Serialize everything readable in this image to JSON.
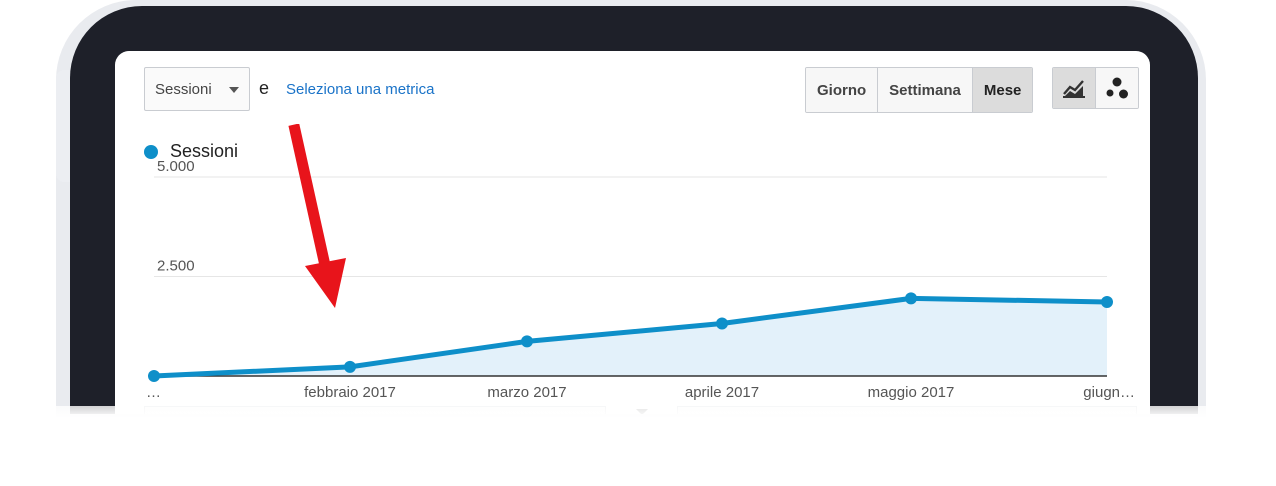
{
  "toolbar": {
    "metric_selected": "Sessioni",
    "conjunction": "e",
    "secondary_metric_link": "Seleziona una metrica",
    "periods": [
      {
        "label": "Giorno",
        "active": false
      },
      {
        "label": "Settimana",
        "active": false
      },
      {
        "label": "Mese",
        "active": true
      }
    ],
    "views": [
      {
        "icon": "line-chart-icon",
        "active": true
      },
      {
        "icon": "motion-chart-icon",
        "active": false
      }
    ]
  },
  "annotation": {
    "icon": "red-arrow-icon",
    "color": "#e8141b"
  },
  "chart_data": {
    "type": "area",
    "x": [
      "…",
      "febbraio 2017",
      "marzo 2017",
      "aprile 2017",
      "maggio 2017",
      "giugn…"
    ],
    "series": [
      {
        "name": "Sessioni",
        "values": [
          0,
          230,
          870,
          1320,
          1950,
          1860
        ],
        "color": "#0e8fc9",
        "fill": "#e3f1fa"
      }
    ],
    "y_ticks": [
      {
        "value": 2500,
        "label": "2.500"
      },
      {
        "value": 5000,
        "label": "5.000"
      }
    ],
    "ylim": [
      0,
      5000
    ],
    "grid": true,
    "legend": "top-left"
  }
}
